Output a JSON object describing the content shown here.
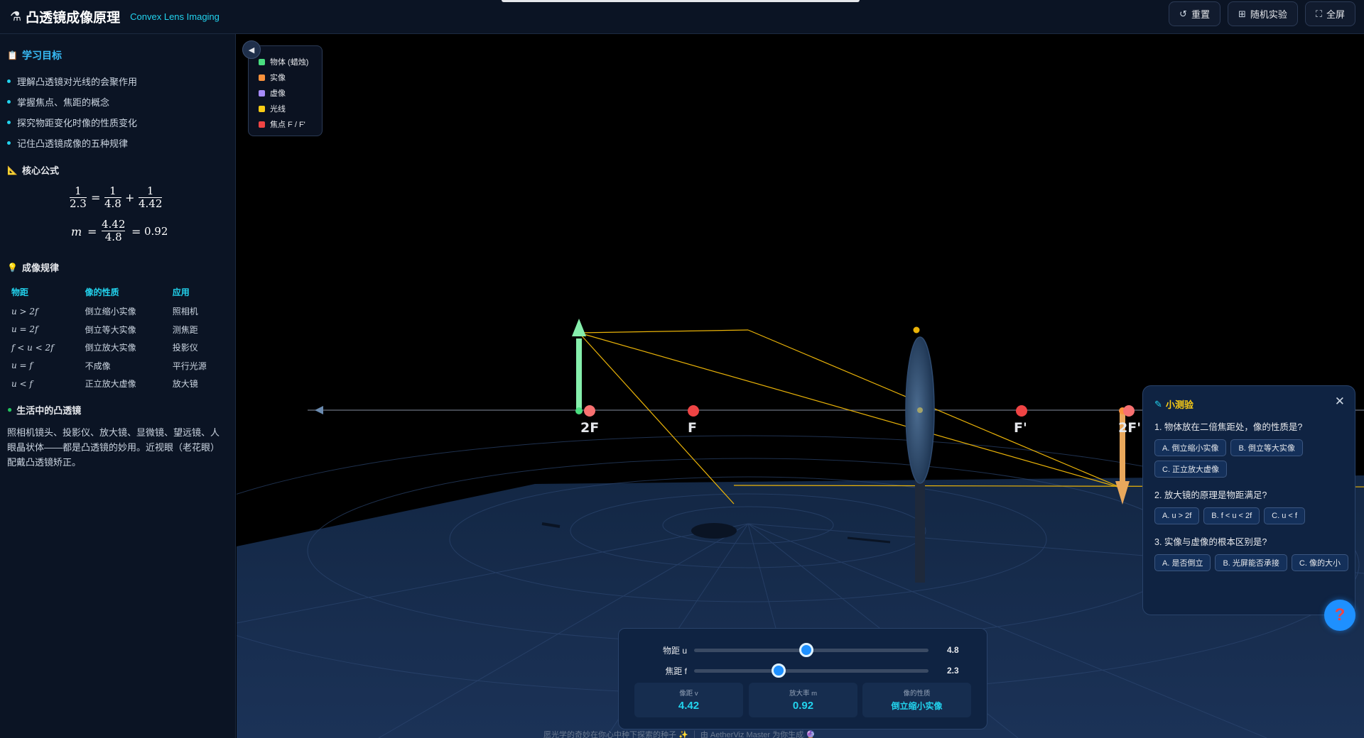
{
  "header": {
    "title": "凸透镜成像原理",
    "subtitle": "Convex Lens Imaging",
    "buttons": {
      "reset": "重置",
      "random": "随机实验",
      "fullscreen": "全屏"
    }
  },
  "sidebar": {
    "goals_title": "学习目标",
    "goals": [
      "理解凸透镜对光线的会聚作用",
      "掌握焦点、焦距的概念",
      "探究物距变化时像的性质变化",
      "记住凸透镜成像的五种规律"
    ],
    "formula_title": "核心公式",
    "formula": {
      "f": "2.3",
      "u": "4.8",
      "v": "4.42",
      "m_symbol": "m",
      "m": "0.92",
      "one": "1",
      "eq": "=",
      "plus": "+"
    },
    "rules_title": "成像规律",
    "rules_headers": [
      "物距",
      "像的性质",
      "应用"
    ],
    "rules": [
      [
        "u > 2f",
        "倒立缩小实像",
        "照相机"
      ],
      [
        "u = 2f",
        "倒立等大实像",
        "测焦距"
      ],
      [
        "f < u < 2f",
        "倒立放大实像",
        "投影仪"
      ],
      [
        "u = f",
        "不成像",
        "平行光源"
      ],
      [
        "u < f",
        "正立放大虚像",
        "放大镜"
      ]
    ],
    "life_title": "生活中的凸透镜",
    "life_text": "照相机镜头、投影仪、放大镜、显微镜、望远镜、人眼晶状体——都是凸透镜的妙用。近视眼（老花眼）配戴凸透镜矫正。"
  },
  "legend": {
    "items": [
      {
        "label": "物体 (蜡烛)",
        "color": "#4ade80"
      },
      {
        "label": "实像",
        "color": "#fb923c"
      },
      {
        "label": "虚像",
        "color": "#a78bfa"
      },
      {
        "label": "光线",
        "color": "#facc15"
      },
      {
        "label": "焦点 F / F'",
        "color": "#ef4444"
      }
    ]
  },
  "scene_labels": {
    "twoF": "2F",
    "F": "F",
    "Fp": "F'",
    "twoFp": "2F'"
  },
  "quiz": {
    "title": "小测验",
    "questions": [
      {
        "q": "1. 物体放在二倍焦距处，像的性质是?",
        "options": [
          "A. 倒立缩小实像",
          "B. 倒立等大实像",
          "C. 正立放大虚像"
        ]
      },
      {
        "q": "2. 放大镜的原理是物距满足?",
        "options": [
          "A. u > 2f",
          "B. f < u < 2f",
          "C. u < f"
        ]
      },
      {
        "q": "3. 实像与虚像的根本区别是?",
        "options": [
          "A. 是否倒立",
          "B. 光屏能否承接",
          "C. 像的大小"
        ]
      }
    ]
  },
  "controls": {
    "object_distance": {
      "label": "物距 u",
      "value": 4.8,
      "display": "4.8",
      "min": 0,
      "max": 10
    },
    "focal_length": {
      "label": "焦距 f",
      "value": 2.3,
      "display": "2.3",
      "min": 0,
      "max": 6.4
    },
    "stats": [
      {
        "label": "像距 v",
        "value": "4.42"
      },
      {
        "label": "放大率 m",
        "value": "0.92"
      },
      {
        "label": "像的性质",
        "value": "倒立缩小实像"
      }
    ]
  },
  "footer": "愿光学的奇妙在你心中种下探索的种子 ✨ ｜ 由 AetherViz Master 为你生成 🔮"
}
